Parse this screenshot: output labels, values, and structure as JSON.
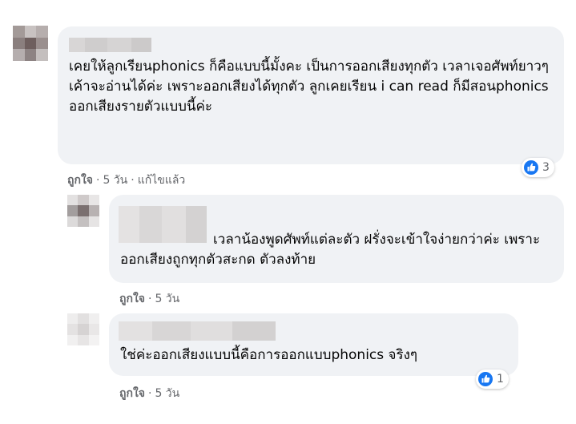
{
  "comments": [
    {
      "text": "เคยให้ลูกเรียนphonics ก็คือแบบนี้มั้งคะ เป็นการออกเสียงทุกตัว เวลาเจอศัพท์ยาวๆเค้าจะอ่านได้ค่ะ เพราะออกเสียงได้ทุกตัว ลูกเคยเรียน i can read ก็มีสอนphonics ออกเสียงรายตัวแบบนี้ค่ะ",
      "like_label": "ถูกใจ",
      "time": "5 วัน",
      "edited_label": "แก้ไขแล้ว",
      "reaction_count": "3"
    },
    {
      "text": "เวลาน้องพูดศัพท์แต่ละตัว ฝรั่งจะเข้าใจง่ายกว่าค่ะ เพราะออกเสียงถูกทุกตัวสะกด ตัวลงท้าย",
      "like_label": "ถูกใจ",
      "time": "5 วัน"
    },
    {
      "text": "ใช่ค่ะออกเสียงแบบนี้คือการออกแบบphonics จริงๆ",
      "like_label": "ถูกใจ",
      "time": "5 วัน",
      "reaction_count": "1"
    }
  ],
  "colors": {
    "bubble": "#f0f2f5",
    "meta_text": "#65676b",
    "like_blue": "#1877f2"
  },
  "icons": {
    "reaction": "thumbs-up-icon"
  }
}
